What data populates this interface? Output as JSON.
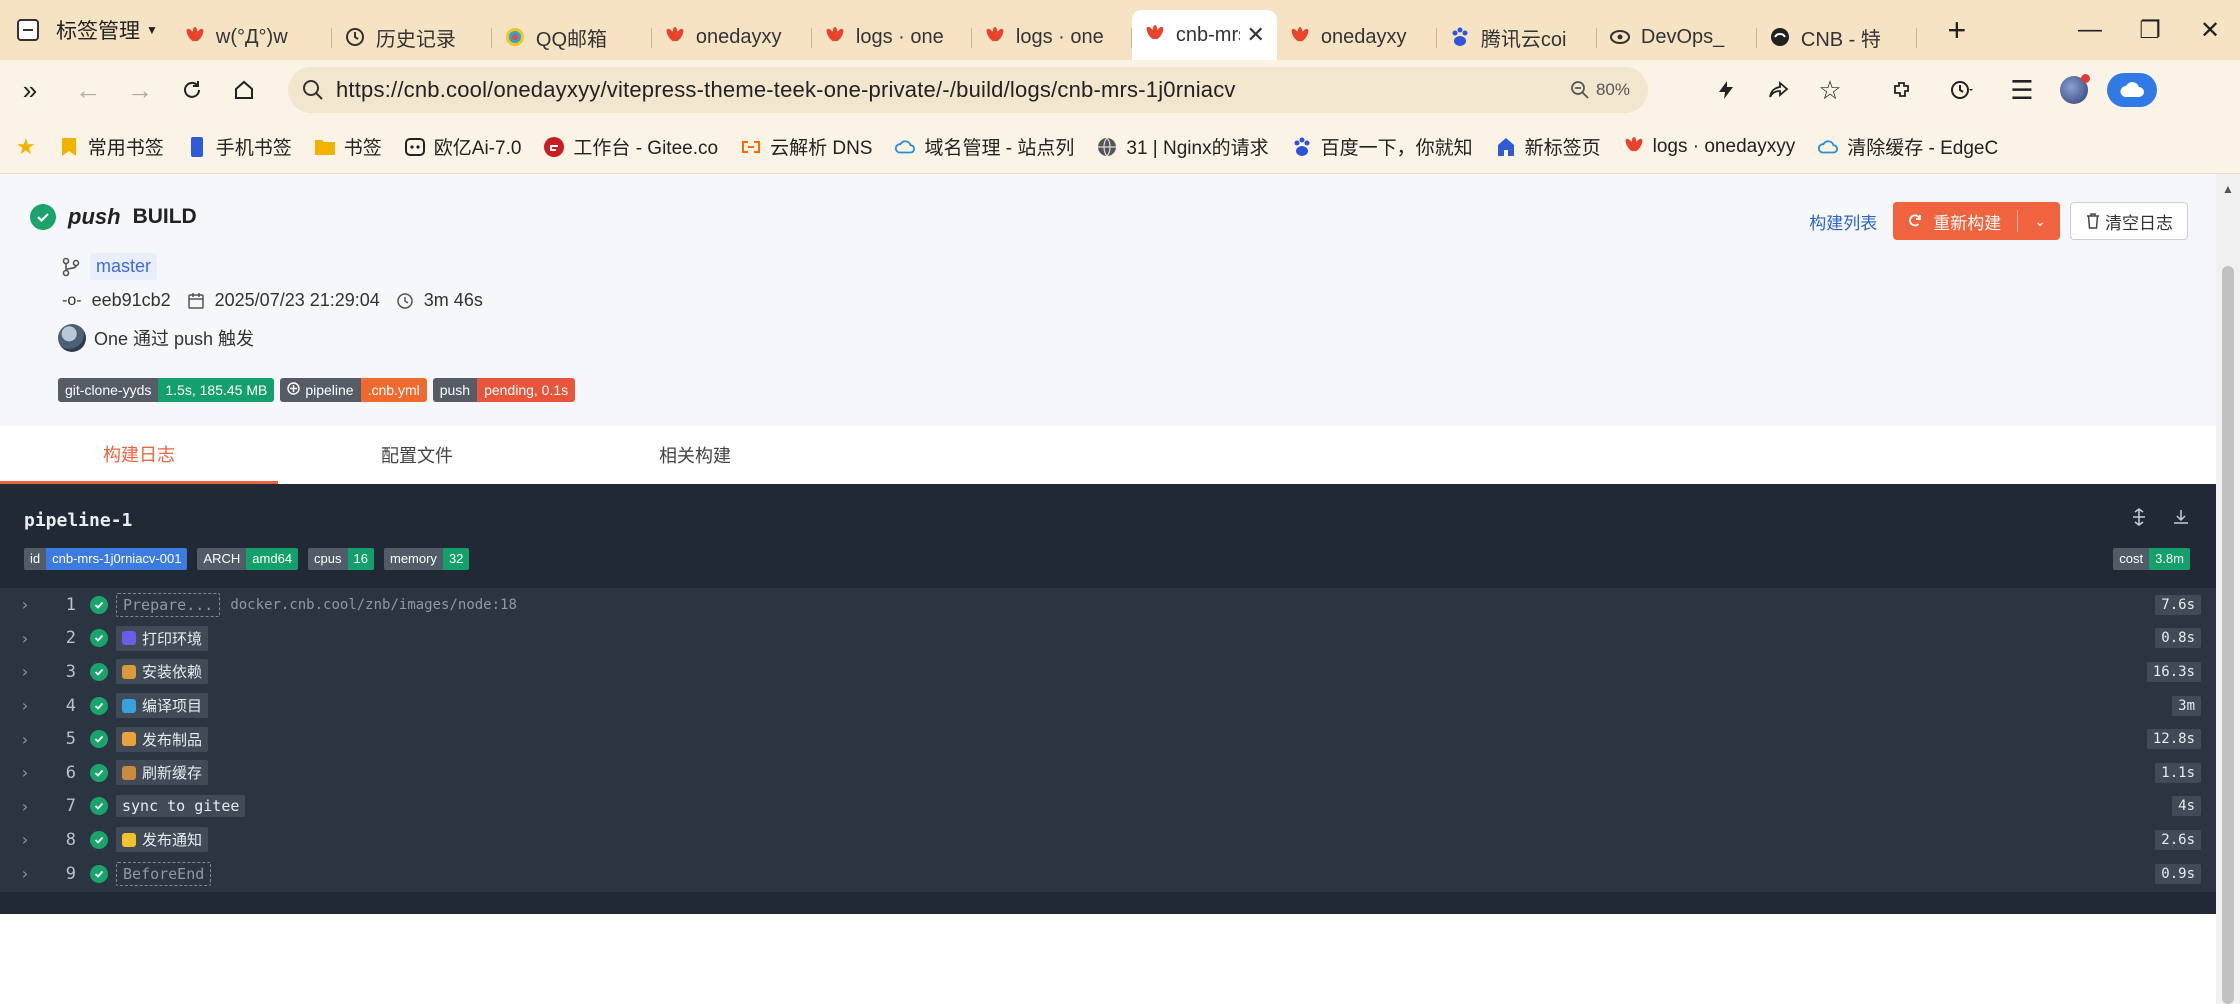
{
  "browser": {
    "tab_group": "标签管理",
    "tabs": [
      {
        "label": "w(°Д°)w",
        "icon": "huawei-icon"
      },
      {
        "label": "历史记录",
        "icon": "history-icon"
      },
      {
        "label": "QQ邮箱",
        "icon": "qq-mail-icon"
      },
      {
        "label": "onedayxy",
        "icon": "huawei-icon"
      },
      {
        "label": "logs · one",
        "icon": "huawei-icon"
      },
      {
        "label": "logs · one",
        "icon": "huawei-icon"
      },
      {
        "label": "cnb-mrs",
        "icon": "huawei-icon",
        "active": true
      },
      {
        "label": "onedayxy",
        "icon": "huawei-icon"
      },
      {
        "label": "腾讯云coi",
        "icon": "baidu-icon"
      },
      {
        "label": "DevOps_",
        "icon": "devops-icon"
      },
      {
        "label": "CNB - 特",
        "icon": "cnb-icon"
      }
    ],
    "url": "https://cnb.cool/onedayxyy/vitepress-theme-teek-one-private/-/build/logs/cnb-mrs-1j0rniacv",
    "zoom": "80%",
    "bookmarks": [
      {
        "label": "常用书签",
        "icon": "bookmark-icon"
      },
      {
        "label": "手机书签",
        "icon": "phone-icon"
      },
      {
        "label": "书签",
        "icon": "folder-icon"
      },
      {
        "label": "欧亿Ai-7.0",
        "icon": "ai-icon"
      },
      {
        "label": "工作台 - Gitee.co",
        "icon": "gitee-icon"
      },
      {
        "label": "云解析 DNS",
        "icon": "aliyun-icon"
      },
      {
        "label": "域名管理 - 站点列",
        "icon": "cloud-icon"
      },
      {
        "label": "31 | Nginx的请求",
        "icon": "globe-icon"
      },
      {
        "label": "百度一下，你就知",
        "icon": "baidu-icon"
      },
      {
        "label": "新标签页",
        "icon": "newtab-icon"
      },
      {
        "label": "logs · onedayxyy",
        "icon": "huawei-icon"
      },
      {
        "label": "清除缓存 - EdgeC",
        "icon": "cloud-icon"
      }
    ]
  },
  "build": {
    "trigger": "push",
    "title": "BUILD",
    "branch": "master",
    "commit": "eeb91cb2",
    "datetime": "2025/07/23 21:29:04",
    "duration": "3m 46s",
    "triggered_by": "One 通过 push 触发",
    "badges": [
      {
        "key": "git-clone-yyds",
        "value": "1.5s, 185.45 MB",
        "color": "green"
      },
      {
        "key": "pipeline",
        "value": ".cnb.yml",
        "color": "orange"
      },
      {
        "key": "push",
        "value": "pending, 0.1s",
        "color": "red"
      }
    ],
    "actions": {
      "list": "构建列表",
      "rebuild": "重新构建",
      "clear": "清空日志"
    }
  },
  "page_tabs": [
    "构建日志",
    "配置文件",
    "相关构建"
  ],
  "pipeline": {
    "name": "pipeline-1",
    "tags": [
      {
        "key": "id",
        "value": "cnb-mrs-1j0rniacv-001",
        "color": "#3c7be0"
      },
      {
        "key": "ARCH",
        "value": "amd64",
        "color": "#14a06a"
      },
      {
        "key": "cpus",
        "value": "16",
        "color": "#14a06a"
      },
      {
        "key": "memory",
        "value": "32",
        "color": "#14a06a"
      }
    ],
    "cost": {
      "key": "cost",
      "value": "3.8m"
    },
    "steps": [
      {
        "num": "1",
        "name": "Prepare...",
        "style": "dashed",
        "image": "docker.cnb.cool/znb/images/node:18",
        "dur": "7.6s"
      },
      {
        "num": "2",
        "name": "打印环境",
        "emoji": "#6c5ce7",
        "dur": "0.8s"
      },
      {
        "num": "3",
        "name": "安装依赖",
        "emoji": "#d99a3a",
        "dur": "16.3s"
      },
      {
        "num": "4",
        "name": "编译项目",
        "emoji": "#3aa0d9",
        "dur": "3m"
      },
      {
        "num": "5",
        "name": "发布制品",
        "emoji": "#e8a33a",
        "dur": "12.8s"
      },
      {
        "num": "6",
        "name": "刷新缓存",
        "emoji": "#c98a3a",
        "dur": "1.1s"
      },
      {
        "num": "7",
        "name": "sync to gitee",
        "style": "mono",
        "dur": "4s"
      },
      {
        "num": "8",
        "name": "发布通知",
        "emoji": "#f2c230",
        "dur": "2.6s"
      },
      {
        "num": "9",
        "name": "BeforeEnd",
        "style": "dashed",
        "dur": "0.9s"
      }
    ]
  }
}
